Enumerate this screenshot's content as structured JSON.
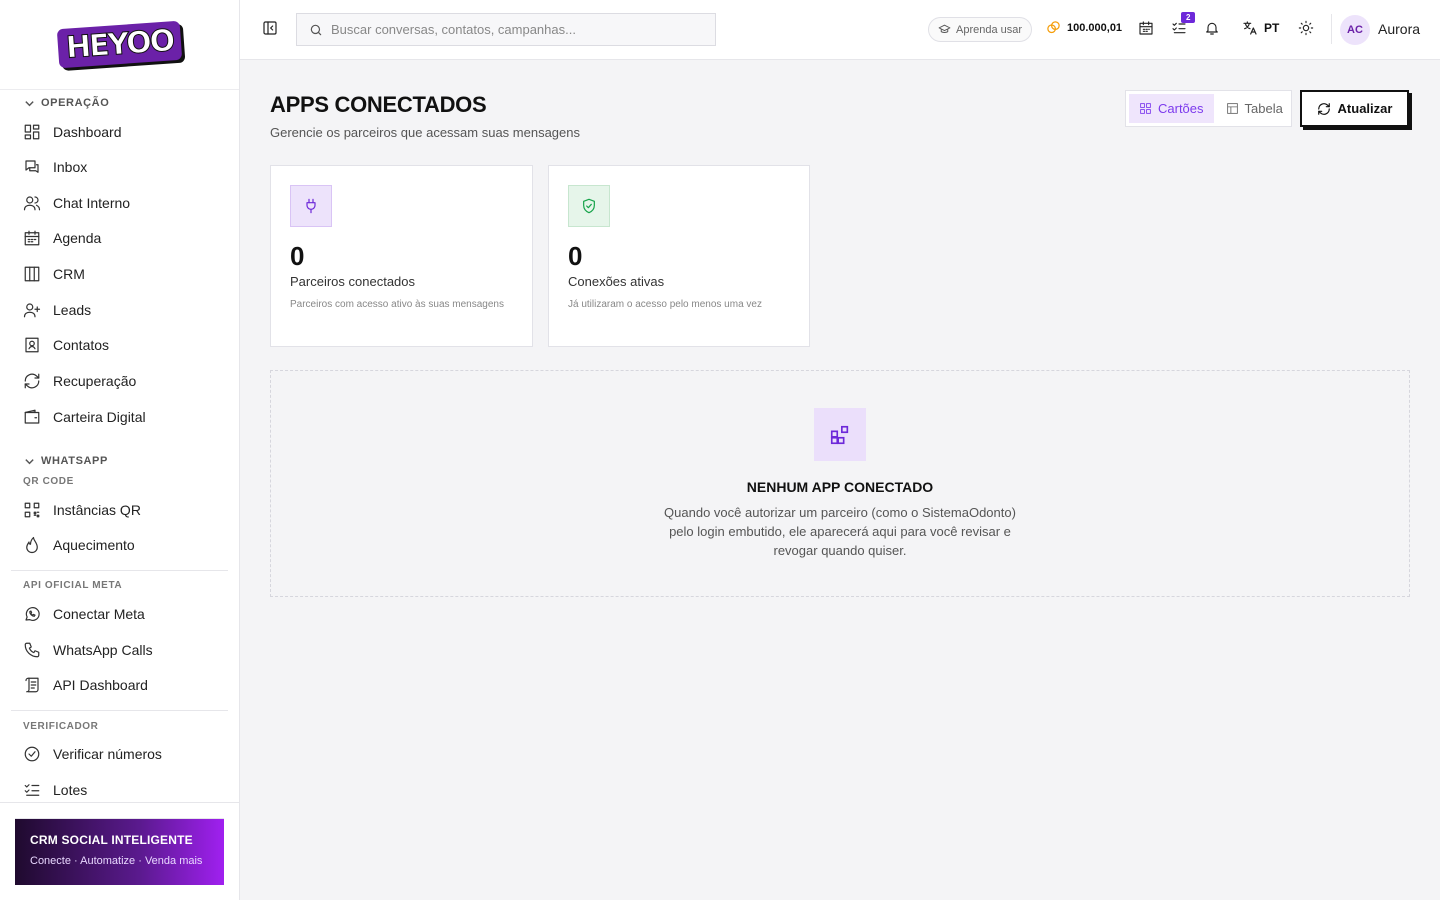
{
  "app": {
    "logo_text": "HEYOO"
  },
  "sidebar": {
    "sections": [
      {
        "title": "OPERAÇÃO"
      },
      {
        "title": "WHATSAPP"
      }
    ],
    "subsections": [
      "QR CODE",
      "API OFICIAL META",
      "VERIFICADOR"
    ],
    "items": [
      {
        "label": "Dashboard",
        "icon": "dashboard-icon"
      },
      {
        "label": "Inbox",
        "icon": "inbox-icon"
      },
      {
        "label": "Chat Interno",
        "icon": "users-icon"
      },
      {
        "label": "Agenda",
        "icon": "calendar-icon"
      },
      {
        "label": "CRM",
        "icon": "kanban-icon"
      },
      {
        "label": "Leads",
        "icon": "user-plus-icon"
      },
      {
        "label": "Contatos",
        "icon": "contact-book-icon"
      },
      {
        "label": "Recuperação",
        "icon": "refresh-icon"
      },
      {
        "label": "Carteira Digital",
        "icon": "wallet-icon"
      },
      {
        "label": "Instâncias QR",
        "icon": "qr-code-icon"
      },
      {
        "label": "Aquecimento",
        "icon": "flame-icon"
      },
      {
        "label": "Conectar Meta",
        "icon": "whatsapp-icon"
      },
      {
        "label": "WhatsApp Calls",
        "icon": "phone-icon"
      },
      {
        "label": "API Dashboard",
        "icon": "scroll-icon"
      },
      {
        "label": "Verificar números",
        "icon": "check-circle-icon"
      },
      {
        "label": "Lotes",
        "icon": "list-checks-icon"
      }
    ],
    "promo": {
      "title": "CRM SOCIAL INTELIGENTE",
      "subtitle": "Conecte · Automatize · Venda mais"
    }
  },
  "topbar": {
    "search_placeholder": "Buscar conversas, contatos, campanhas...",
    "learn_label": "Aprenda usar",
    "credits": "100.000,01",
    "tasks_badge": "2",
    "language": "PT",
    "avatar_initials": "AC",
    "user_name": "Aurora"
  },
  "main": {
    "title": "APPS CONECTADOS",
    "subtitle": "Gerencie os parceiros que acessam suas mensagens",
    "view_options": [
      "Cartões",
      "Tabela"
    ],
    "active_view": "Cartões",
    "refresh_label": "Atualizar",
    "stats": [
      {
        "value": "0",
        "label": "Parceiros conectados",
        "desc": "Parceiros com acesso ativo às suas mensagens",
        "icon": "plug-icon",
        "color": "#6d28d9"
      },
      {
        "value": "0",
        "label": "Conexões ativas",
        "desc": "Já utilizaram o acesso pelo menos uma vez",
        "icon": "shield-check-icon",
        "color": "#16a34a"
      }
    ],
    "empty_state": {
      "title": "NENHUM APP CONECTADO",
      "description": "Quando você autorizar um parceiro (como o SistemaOdonto) pelo login embutido, ele aparecerá aqui para você revisar e revogar quando quiser."
    }
  },
  "colors": {
    "accent": "#6d28d9",
    "success": "#16a34a",
    "credits": "#f59e0b"
  }
}
